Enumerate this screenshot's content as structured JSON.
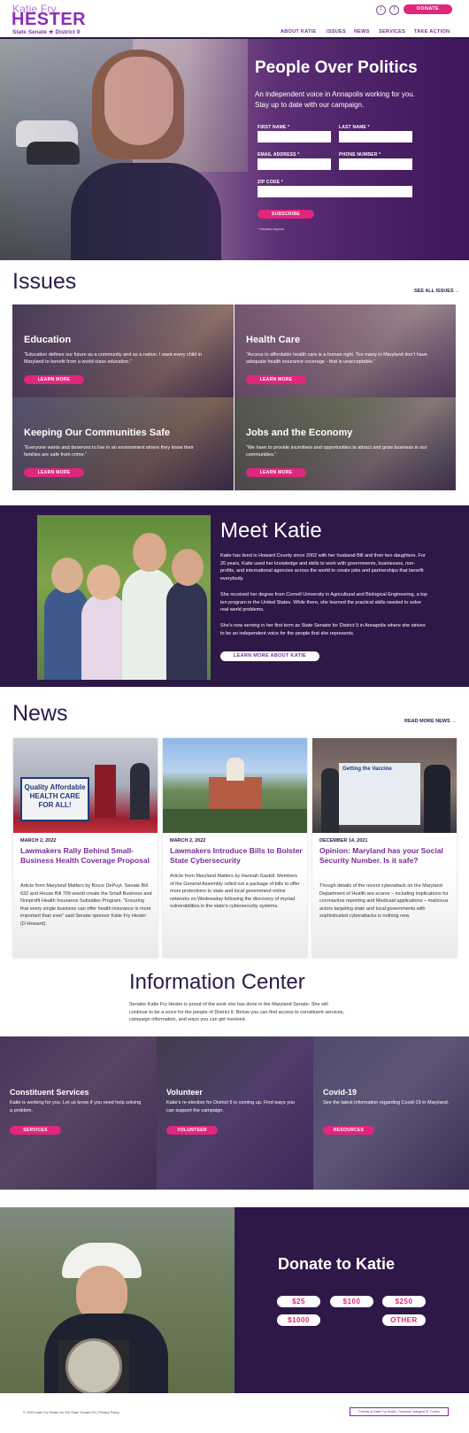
{
  "header": {
    "logo_top": "Katie Fry",
    "logo_main": "HESTER",
    "logo_sub": "State Senate ★ District 9",
    "social": [
      {
        "icon": "twitter-icon",
        "glyph": "t"
      },
      {
        "icon": "facebook-icon",
        "glyph": "f"
      }
    ],
    "donate_label": "DONATE",
    "nav": [
      "ABOUT KATIE",
      "ISSUES",
      "NEWS",
      "SERVICES",
      "TAKE ACTION"
    ]
  },
  "hero": {
    "title": "People Over Politics",
    "intro": "An independent voice in Annapolis working for you. Stay up to date with our campaign.",
    "fields": {
      "first_name": "FIRST NAME *",
      "last_name": "LAST NAME *",
      "email": "EMAIL ADDRESS *",
      "phone": "PHONE NUMBER *",
      "zip": "ZIP CODE *"
    },
    "subscribe_label": "SUBSCRIBE",
    "required_note": "* indicates required"
  },
  "issues": {
    "title": "Issues",
    "see_all": "SEE ALL ISSUES →",
    "learn_more": "LEARN MORE",
    "items": [
      {
        "title": "Education",
        "text": "“Education defines our future as a community and as a nation. I want every child in Maryland to benefit from a world-class education.”"
      },
      {
        "title": "Health Care",
        "text": "“Access to affordable health care is a human right. Too many in Maryland don’t have adequate health insurance coverage - that is unacceptable.”"
      },
      {
        "title": "Keeping Our Communities Safe",
        "text": "“Everyone wants and deserves to live in an environment where they know their families are safe from crime.”"
      },
      {
        "title": "Jobs and the Economy",
        "text": "“We have to provide incentives and opportunities to attract and grow business in our communities.”"
      }
    ]
  },
  "meet": {
    "title": "Meet Katie",
    "paragraphs": [
      "Katie has lived in Howard County since 2002 with her husband Bill and their two daughters. For 20 years, Katie used her knowledge and skills to work with governments, businesses, non-profits, and international agencies across the world to create jobs and partnerships that benefit everybody.",
      "She received her degree from Cornell University in Agricultural and Biological Engineering, a top ten program in the United States. While there, she learned the practical skills needed to solve real world problems.",
      "She’s now serving in her first term as State Senator for District 9 in Annapolis where she strives to be an independent voice for the people that she represents."
    ],
    "button": "LEARN MORE ABOUT KATIE"
  },
  "news": {
    "title": "News",
    "read_more": "READ MORE NEWS →",
    "items": [
      {
        "date": "MARCH 2, 2022",
        "headline": "Lawmakers Rally Behind Small-Business Health Coverage Proposal",
        "body": "Article from Maryland Matters by Bruce DePuyt. Senate Bill 632 and House Bill 709 would create the Small Business and Nonprofit Health Insurance Subsidies Program. “Ensuring that every single business can offer health insurance is more important than ever” said Senate sponsor Katie Fry Hester (D-Howard).",
        "sign_text": "Quality Affordable HEALTH CARE FOR ALL!"
      },
      {
        "date": "MARCH 2, 2022",
        "headline": "Lawmakers Introduce Bills to Bolster State Cybersecurity",
        "body": "Article from Maryland Matters by Hannah Gaskill. Members of the General Assembly rolled out a package of bills to offer more protections to state and local government online networks on Wednesday following the discovery of myriad vulnerabilities in the state’s cybersecurity systems."
      },
      {
        "date": "DECEMBER 14, 2021",
        "headline": "Opinion: Maryland has your Social Security Number. Is it safe?",
        "body": "Though details of the recent cyberattack on the Maryland Department of Health are scarce – including implications for coronavirus reporting and Medicaid applications – malicious actors targeting state and local governments with sophisticated cyberattacks is nothing new.",
        "screen_text": "Getting the Vaccine"
      }
    ]
  },
  "info": {
    "title": "Information Center",
    "text": "Senator Katie Fry Hester is proud of the work she has done in the Maryland Senate. She will continue to be a voice for the people of District 9. Below you can find access to constituent services, campaign information, and ways you can get involved.",
    "panels": [
      {
        "title": "Constituent Services",
        "text": "Katie is working for you. Let us know if you need help solving a problem.",
        "button": "SERVICES"
      },
      {
        "title": "Volunteer",
        "text": "Katie’s re-election for District 9 is coming up. Find ways you can support the campaign.",
        "button": "VOLUNTEER"
      },
      {
        "title": "Covid-19",
        "text": "See the latest information regarding Covid-19 in Maryland.",
        "button": "RESOURCES"
      }
    ]
  },
  "donate": {
    "title": "Donate to Katie",
    "amounts": [
      "$25",
      "$100",
      "$250",
      "$1000",
      "OTHER"
    ]
  },
  "footer": {
    "copyright": "© 2020 Katie Fry Hester for MD State Senate D9 | Privacy Policy",
    "authority": "Friends of Katie Fry Hester, Treasurer Margaret E. Corbin"
  },
  "colors": {
    "accent": "#e0267d",
    "brand_purple": "#7a2a9a",
    "dark_purple": "#2d1847"
  }
}
